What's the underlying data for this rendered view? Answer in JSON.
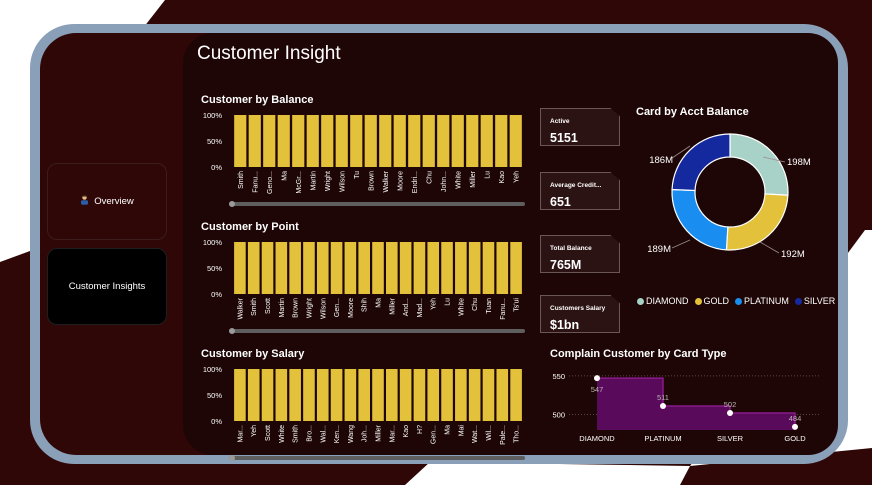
{
  "page_title": "Customer Insight",
  "nav": {
    "overview_label": "Overview",
    "insights_label": "Customer Insights"
  },
  "colors": {
    "bar": "#e3c13b",
    "panel": "#1e0606",
    "diamond": "#a8d2c8",
    "gold": "#e3c13b",
    "platinum": "#1a8ef0",
    "silver": "#15299e",
    "complaint": "#5a0a5a"
  },
  "icons": {
    "overview_icon": "person-icon"
  },
  "kpis": [
    {
      "label": "Active",
      "value": "5151"
    },
    {
      "label": "Average Credit...",
      "value": "651"
    },
    {
      "label": "Total Balance",
      "value": "765M"
    },
    {
      "label": "Customers Salary",
      "value": "$1bn"
    }
  ],
  "charts": {
    "balance_title": "Customer by Balance",
    "point_title": "Customer by Point",
    "salary_title": "Customer by Salary",
    "donut_title": "Card by Acct Balance",
    "complain_title": "Complain Customer by Card Type"
  },
  "chart_data": [
    {
      "type": "bar",
      "title": "Customer by Balance",
      "y_ticks": [
        "100%",
        "50%",
        "0%"
      ],
      "ylim": [
        0,
        100
      ],
      "categories": [
        "Smith",
        "Fanu...",
        "Geno...",
        "Ma",
        "McGr...",
        "Martin",
        "Wright",
        "Wilson",
        "Tu",
        "Brown",
        "Walker",
        "Moore",
        "Endri...",
        "Chu",
        "John...",
        "White",
        "Miller",
        "Lu",
        "Kao",
        "Yeh"
      ],
      "values": [
        100,
        100,
        100,
        100,
        100,
        100,
        100,
        100,
        100,
        100,
        100,
        100,
        100,
        100,
        100,
        100,
        100,
        100,
        100,
        100
      ]
    },
    {
      "type": "bar",
      "title": "Customer by Point",
      "y_ticks": [
        "100%",
        "50%",
        "0%"
      ],
      "ylim": [
        0,
        100
      ],
      "categories": [
        "Walker",
        "Smith",
        "Scott",
        "Martin",
        "Brown",
        "Wright",
        "Wilson",
        "Gen...",
        "Moore",
        "Shih",
        "Ma",
        "Miller",
        "And...",
        "Mad...",
        "Yeh",
        "Lu",
        "White",
        "Chu",
        "Tuan",
        "Fanu...",
        "Ts'ui"
      ],
      "values": [
        100,
        100,
        100,
        100,
        100,
        100,
        100,
        100,
        100,
        100,
        100,
        100,
        100,
        100,
        100,
        100,
        100,
        100,
        100,
        100,
        100
      ]
    },
    {
      "type": "bar",
      "title": "Customer by Salary",
      "y_ticks": [
        "100%",
        "50%",
        "0%"
      ],
      "ylim": [
        0,
        100
      ],
      "categories": [
        "Mar...",
        "Yeh",
        "Scott",
        "White",
        "Smith",
        "Bro...",
        "Wal...",
        "Ken...",
        "Wang",
        "Joh...",
        "Miller",
        "Mar...",
        "Kao",
        "H?",
        "Gen...",
        "Ma",
        "Mai",
        "Wat...",
        "Wil...",
        "Pale...",
        "Tho..."
      ],
      "values": [
        100,
        100,
        100,
        100,
        100,
        100,
        100,
        100,
        100,
        100,
        100,
        100,
        100,
        100,
        100,
        100,
        100,
        100,
        100,
        100,
        100
      ]
    },
    {
      "type": "pie",
      "title": "Card by Acct Balance",
      "categories": [
        "DIAMOND",
        "GOLD",
        "PLATINUM",
        "SILVER"
      ],
      "values": [
        198,
        192,
        189,
        186
      ],
      "labels": [
        "198M",
        "192M",
        "189M",
        "186M"
      ],
      "legend": "bottom"
    },
    {
      "type": "area",
      "title": "Complain Customer by Card Type",
      "categories": [
        "DIAMOND",
        "PLATINUM",
        "SILVER",
        "GOLD"
      ],
      "values": [
        547,
        511,
        502,
        484
      ],
      "y_ticks": [
        "550",
        "500"
      ],
      "ylim": [
        480,
        555
      ],
      "step": true
    }
  ]
}
